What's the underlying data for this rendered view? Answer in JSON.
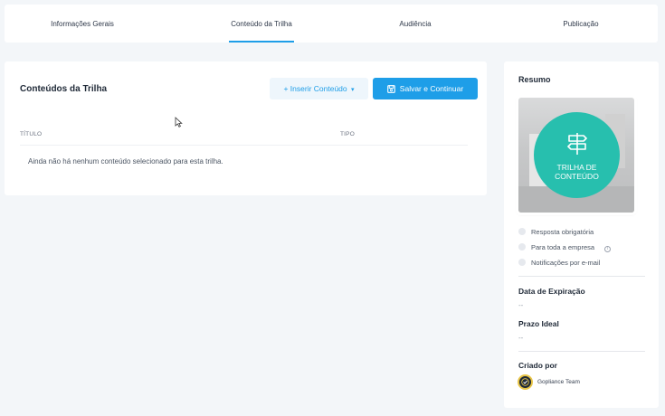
{
  "tabs": [
    {
      "label": "Informações Gerais",
      "active": false
    },
    {
      "label": "Conteúdo da Trilha",
      "active": true
    },
    {
      "label": "Audiência",
      "active": false
    },
    {
      "label": "Publicação",
      "active": false
    }
  ],
  "main": {
    "title": "Conteúdos da Trilha",
    "insert_button": {
      "icon": "plus-icon",
      "label": "Inserir Conteúdo"
    },
    "save_button": {
      "icon": "save-icon",
      "label": "Salvar e Continuar"
    },
    "columns": [
      "TÍTULO",
      "TIPO"
    ],
    "empty_message": "Ainda não há nenhum conteúdo selecionado para esta trilha."
  },
  "sidebar": {
    "title": "Resumo",
    "thumbnail": {
      "icon": "signpost-icon",
      "line1": "TRILHA DE",
      "line2": "CONTEÚDO"
    },
    "options": [
      {
        "label": "Resposta obrigatória",
        "checked": false
      },
      {
        "label": "Para toda a empresa",
        "checked": false,
        "info": "i"
      },
      {
        "label": "Notificações por e-mail",
        "checked": false
      }
    ],
    "expiration": {
      "label": "Data de Expiração",
      "value": "--"
    },
    "ideal_deadline": {
      "label": "Prazo Ideal",
      "value": "--"
    },
    "created_by": {
      "label": "Criado por",
      "name": "Gopliance Team"
    }
  },
  "colors": {
    "accent": "#1e9ee8",
    "badge": "#27bfae",
    "background": "#f3f6f9"
  }
}
